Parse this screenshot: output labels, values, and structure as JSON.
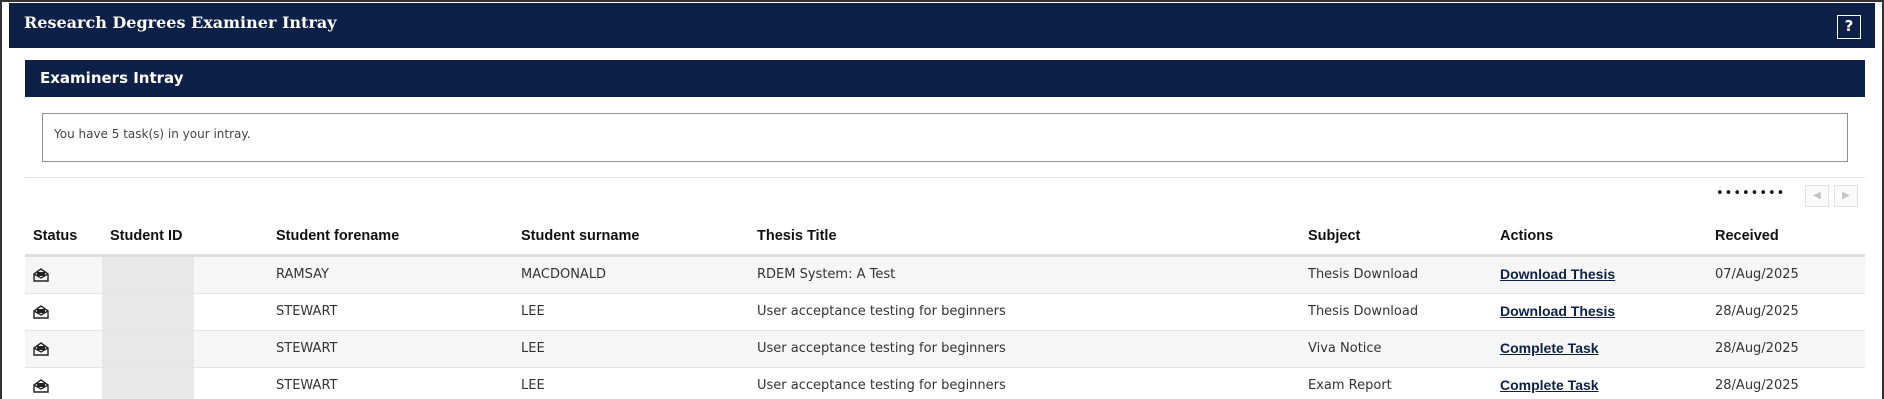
{
  "header": {
    "title": "Research Degrees Examiner Intray",
    "help_label": "?"
  },
  "panel": {
    "title": "Examiners Intray"
  },
  "info": {
    "message": "You have 5 task(s) in your intray."
  },
  "pager": {
    "dots": "••••••••",
    "prev_icon": "chevron-left-icon",
    "prev_label": "◀",
    "next_icon": "chevron-right-icon",
    "next_label": "▶"
  },
  "table": {
    "columns": [
      "Status",
      "Student ID",
      "Student forename",
      "Student surname",
      "Thesis Title",
      "Subject",
      "Actions",
      "Received"
    ],
    "rows": [
      {
        "status_icon": "envelope-icon",
        "student_id": "",
        "forename": "RAMSAY",
        "surname": "MACDONALD",
        "thesis_title": "RDEM System: A Test",
        "subject": "Thesis Download",
        "action": "Download Thesis",
        "received": "07/Aug/2025"
      },
      {
        "status_icon": "envelope-icon",
        "student_id": "",
        "forename": "STEWART",
        "surname": "LEE",
        "thesis_title": "User acceptance testing for beginners",
        "subject": "Thesis Download",
        "action": "Download Thesis",
        "received": "28/Aug/2025"
      },
      {
        "status_icon": "envelope-icon",
        "student_id": "",
        "forename": "STEWART",
        "surname": "LEE",
        "thesis_title": "User acceptance testing for beginners",
        "subject": "Viva Notice",
        "action": "Complete Task",
        "received": "28/Aug/2025"
      },
      {
        "status_icon": "envelope-icon",
        "student_id": "",
        "forename": "STEWART",
        "surname": "LEE",
        "thesis_title": "User acceptance testing for beginners",
        "subject": "Exam Report",
        "action": "Complete Task",
        "received": "28/Aug/2025"
      }
    ]
  },
  "colors": {
    "navy": "#0d2148",
    "row_alt": "#f6f6f6"
  }
}
